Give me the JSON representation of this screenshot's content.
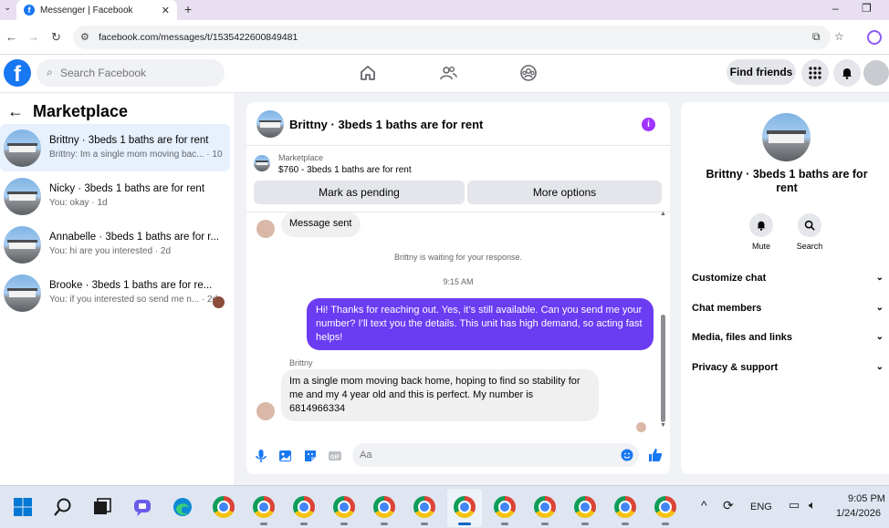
{
  "browser": {
    "tab_title": "Messenger | Facebook",
    "url": "facebook.com/messages/t/1535422600849481"
  },
  "fb": {
    "search_placeholder": "Search Facebook",
    "find_friends": "Find friends"
  },
  "left": {
    "title": "Marketplace",
    "conversations": [
      {
        "name": "Brittny · 3beds 1 baths are for rent",
        "preview": "Brittny: Im a single mom moving bac... · 10h",
        "active": true
      },
      {
        "name": "Nicky · 3beds 1 baths are for rent",
        "preview": "You: okay · 1d",
        "active": false
      },
      {
        "name": "Annabelle · 3beds 1 baths are for r...",
        "preview": "You: hi are you interested · 2d",
        "active": false
      },
      {
        "name": "Brooke · 3beds 1 baths are for re...",
        "preview": "You: if you interested so send me n... · 2d",
        "active": false
      }
    ]
  },
  "chat": {
    "title": "Brittny · 3beds 1 baths are for rent",
    "marketplace_label": "Marketplace",
    "listing": "$760 - 3beds 1 baths are for rent",
    "mark_pending": "Mark as pending",
    "more_options": "More options",
    "msg_sent": "Message sent",
    "waiting": "Brittny is waiting for your response.",
    "time": "9:15 AM",
    "outgoing": "Hi! Thanks for reaching out. Yes, it’s still available. Can you send me your number? I’ll text you the details. This unit has high demand, so acting fast helps!",
    "sender": "Brittny",
    "incoming": "Im a single mom moving back home, hoping to find so stability for me and my 4 year old and this is perfect. My number is 6814966334",
    "composer_placeholder": "Aa"
  },
  "right": {
    "name": "Brittny · 3beds 1 baths are for rent",
    "mute": "Mute",
    "search": "Search",
    "sections": [
      "Customize chat",
      "Chat members",
      "Media, files and links",
      "Privacy & support"
    ]
  },
  "taskbar": {
    "lang": "ENG",
    "time": "9:05 PM",
    "date": "1/24/2026"
  },
  "colors": {
    "brand": "#1877f2",
    "outgoing_bubble": "#6a3cf2",
    "info_icon": "#a033ff"
  }
}
